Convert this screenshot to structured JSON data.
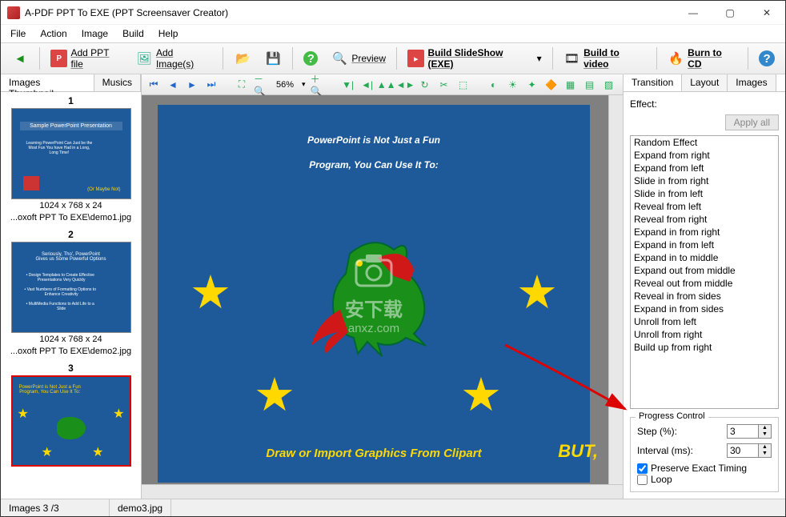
{
  "window": {
    "title": "A-PDF PPT To EXE (PPT Screensaver Creator)"
  },
  "menu": [
    "File",
    "Action",
    "Image",
    "Build",
    "Help"
  ],
  "toolbar": {
    "back": "",
    "add_ppt": "Add PPT file",
    "add_images": "Add Image(s)",
    "open": "",
    "save": "",
    "help": "",
    "preview": "Preview",
    "build_exe": "Build SlideShow (EXE)",
    "build_video": "Build to video",
    "burn_cd": "Burn to CD"
  },
  "thumbtabs": {
    "images": "Images Thumbnail",
    "musics": "Musics"
  },
  "thumbs": [
    {
      "num": "1",
      "meta": "1024 x 768 x 24",
      "path": "...oxoft PPT To EXE\\demo1.jpg",
      "title": "Sample PowerPoint Presentation"
    },
    {
      "num": "2",
      "meta": "1024 x 768 x 24",
      "path": "...oxoft PPT To EXE\\demo2.jpg",
      "title": "Seriously, Tho', PowerPoint Gives us Some Powerful Options"
    },
    {
      "num": "3",
      "meta": "",
      "path": "",
      "title": "PowerPoint is Not Just a Fun Program, You Can Use It To:"
    }
  ],
  "canvasbar": {
    "zoom": "56%"
  },
  "slide": {
    "title_l1": "PowerPoint is Not Just a Fun",
    "title_l2": "Program, You Can Use It To:",
    "caption": "Draw or Import Graphics From Clipart",
    "but": "BUT,"
  },
  "watermark": {
    "l1": "安下载",
    "l2": "anxz.com"
  },
  "panel": {
    "tabs": {
      "transition": "Transition",
      "layout": "Layout",
      "images": "Images"
    },
    "effect_label": "Effect:",
    "apply_all": "Apply all",
    "effects": [
      "Random Effect",
      "Expand from right",
      "Expand from left",
      "Slide in from right",
      "Slide in from left",
      "Reveal from left",
      "Reveal from right",
      "Expand in from right",
      "Expand in from left",
      "Expand in to middle",
      "Expand out from middle",
      "Reveal out from middle",
      "Reveal in from sides",
      "Expand in from sides",
      "Unroll from left",
      "Unroll from right",
      "Build up from right"
    ],
    "progress": {
      "legend": "Progress Control",
      "step_label": "Step (%):",
      "step_value": "3",
      "interval_label": "Interval (ms):",
      "interval_value": "30",
      "preserve": "Preserve Exact Timing",
      "loop": "Loop"
    }
  },
  "status": {
    "count": "Images 3 /3",
    "file": "demo3.jpg"
  }
}
